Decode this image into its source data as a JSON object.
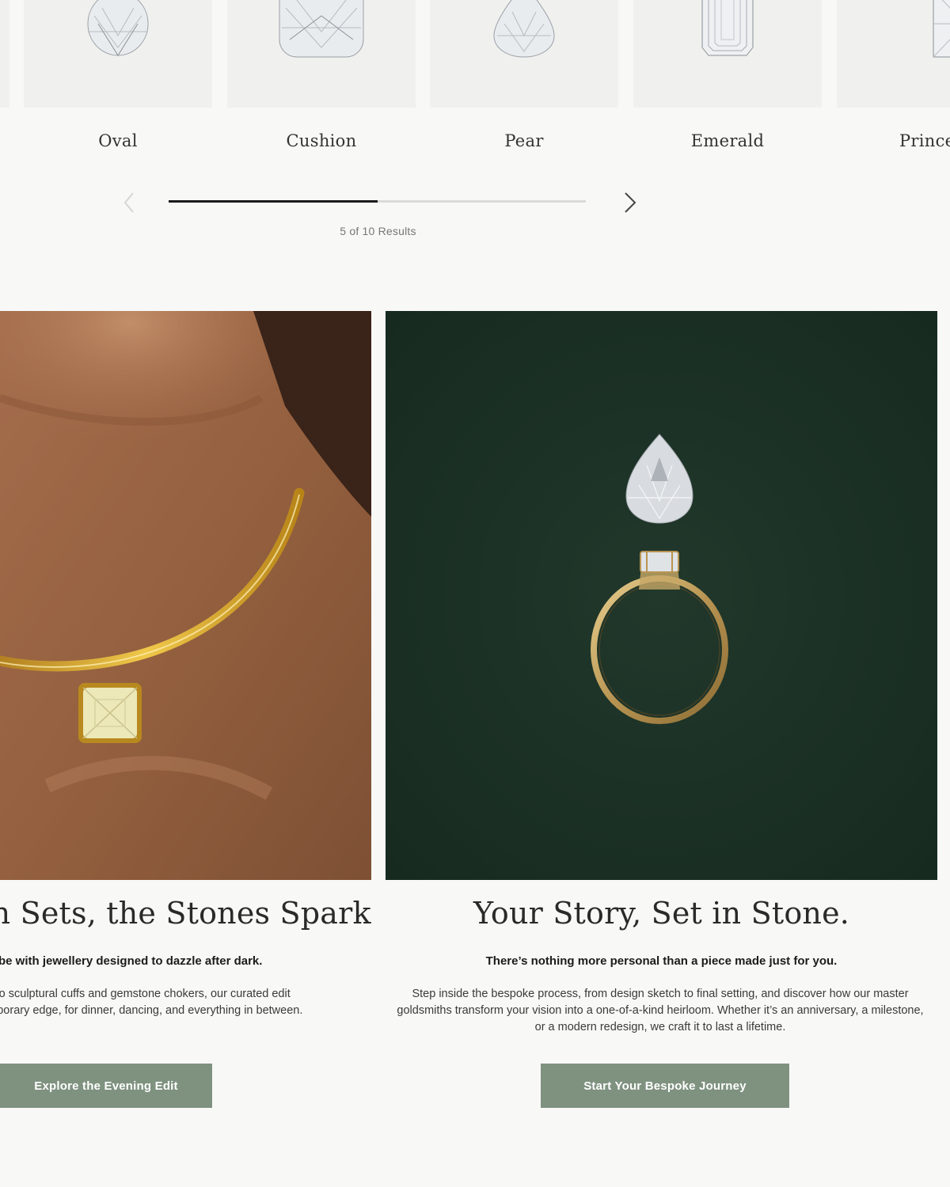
{
  "shapes": {
    "items": [
      {
        "label": "Oval",
        "icon": "oval-diamond-icon"
      },
      {
        "label": "Cushion",
        "icon": "cushion-diamond-icon"
      },
      {
        "label": "Pear",
        "icon": "pear-diamond-icon"
      },
      {
        "label": "Emerald",
        "icon": "emerald-diamond-icon"
      },
      {
        "label": "Prince",
        "icon": "princess-diamond-icon"
      }
    ],
    "prev_icon": "chevron-left-icon",
    "next_icon": "chevron-right-icon",
    "progress_fraction": 0.5,
    "results_text": "5 of 10 Results"
  },
  "features": {
    "left": {
      "image": "gold-collar-necklace-photo",
      "headline": "un Sets, the Stones Sparkle.",
      "subheading": "wardrobe with jewellery designed to dazzle after dark.",
      "body_lines": [
        "ings to sculptural cuffs and gemstone chokers, our curated edit",
        "ntemporary edge, for dinner, dancing, and everything in between."
      ],
      "cta_label": "Explore the Evening Edit"
    },
    "right": {
      "image": "pear-diamond-and-ring-photo",
      "headline": "Your Story, Set in Stone.",
      "subheading": "There’s nothing more personal than a piece made just for you.",
      "body": "Step inside the bespoke process, from design sketch to final setting, and discover how our master goldsmiths transform your vision into a one-of-a-kind heirloom. Whether it’s an anniversary, a milestone, or a modern redesign, we craft it to last a lifetime.",
      "cta_label": "Start Your Bespoke Journey"
    }
  },
  "colors": {
    "page_bg": "#f8f8f7",
    "tile_bg": "#f0f0ee",
    "cta_bg": "#7f9280",
    "green_backdrop": "#1e3328"
  }
}
